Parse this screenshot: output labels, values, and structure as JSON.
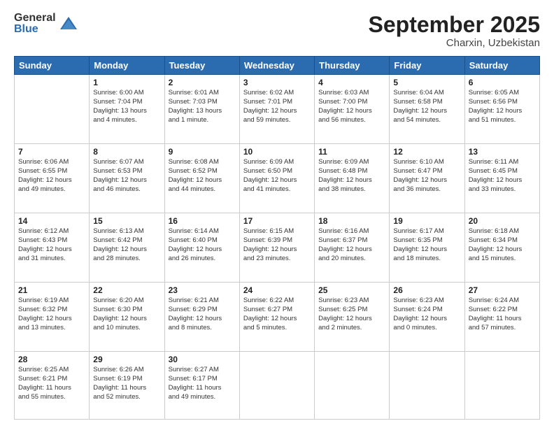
{
  "logo": {
    "general": "General",
    "blue": "Blue"
  },
  "header": {
    "month": "September 2025",
    "location": "Charxin, Uzbekistan"
  },
  "weekdays": [
    "Sunday",
    "Monday",
    "Tuesday",
    "Wednesday",
    "Thursday",
    "Friday",
    "Saturday"
  ],
  "weeks": [
    [
      {
        "day": "",
        "info": ""
      },
      {
        "day": "1",
        "info": "Sunrise: 6:00 AM\nSunset: 7:04 PM\nDaylight: 13 hours\nand 4 minutes."
      },
      {
        "day": "2",
        "info": "Sunrise: 6:01 AM\nSunset: 7:03 PM\nDaylight: 13 hours\nand 1 minute."
      },
      {
        "day": "3",
        "info": "Sunrise: 6:02 AM\nSunset: 7:01 PM\nDaylight: 12 hours\nand 59 minutes."
      },
      {
        "day": "4",
        "info": "Sunrise: 6:03 AM\nSunset: 7:00 PM\nDaylight: 12 hours\nand 56 minutes."
      },
      {
        "day": "5",
        "info": "Sunrise: 6:04 AM\nSunset: 6:58 PM\nDaylight: 12 hours\nand 54 minutes."
      },
      {
        "day": "6",
        "info": "Sunrise: 6:05 AM\nSunset: 6:56 PM\nDaylight: 12 hours\nand 51 minutes."
      }
    ],
    [
      {
        "day": "7",
        "info": "Sunrise: 6:06 AM\nSunset: 6:55 PM\nDaylight: 12 hours\nand 49 minutes."
      },
      {
        "day": "8",
        "info": "Sunrise: 6:07 AM\nSunset: 6:53 PM\nDaylight: 12 hours\nand 46 minutes."
      },
      {
        "day": "9",
        "info": "Sunrise: 6:08 AM\nSunset: 6:52 PM\nDaylight: 12 hours\nand 44 minutes."
      },
      {
        "day": "10",
        "info": "Sunrise: 6:09 AM\nSunset: 6:50 PM\nDaylight: 12 hours\nand 41 minutes."
      },
      {
        "day": "11",
        "info": "Sunrise: 6:09 AM\nSunset: 6:48 PM\nDaylight: 12 hours\nand 38 minutes."
      },
      {
        "day": "12",
        "info": "Sunrise: 6:10 AM\nSunset: 6:47 PM\nDaylight: 12 hours\nand 36 minutes."
      },
      {
        "day": "13",
        "info": "Sunrise: 6:11 AM\nSunset: 6:45 PM\nDaylight: 12 hours\nand 33 minutes."
      }
    ],
    [
      {
        "day": "14",
        "info": "Sunrise: 6:12 AM\nSunset: 6:43 PM\nDaylight: 12 hours\nand 31 minutes."
      },
      {
        "day": "15",
        "info": "Sunrise: 6:13 AM\nSunset: 6:42 PM\nDaylight: 12 hours\nand 28 minutes."
      },
      {
        "day": "16",
        "info": "Sunrise: 6:14 AM\nSunset: 6:40 PM\nDaylight: 12 hours\nand 26 minutes."
      },
      {
        "day": "17",
        "info": "Sunrise: 6:15 AM\nSunset: 6:39 PM\nDaylight: 12 hours\nand 23 minutes."
      },
      {
        "day": "18",
        "info": "Sunrise: 6:16 AM\nSunset: 6:37 PM\nDaylight: 12 hours\nand 20 minutes."
      },
      {
        "day": "19",
        "info": "Sunrise: 6:17 AM\nSunset: 6:35 PM\nDaylight: 12 hours\nand 18 minutes."
      },
      {
        "day": "20",
        "info": "Sunrise: 6:18 AM\nSunset: 6:34 PM\nDaylight: 12 hours\nand 15 minutes."
      }
    ],
    [
      {
        "day": "21",
        "info": "Sunrise: 6:19 AM\nSunset: 6:32 PM\nDaylight: 12 hours\nand 13 minutes."
      },
      {
        "day": "22",
        "info": "Sunrise: 6:20 AM\nSunset: 6:30 PM\nDaylight: 12 hours\nand 10 minutes."
      },
      {
        "day": "23",
        "info": "Sunrise: 6:21 AM\nSunset: 6:29 PM\nDaylight: 12 hours\nand 8 minutes."
      },
      {
        "day": "24",
        "info": "Sunrise: 6:22 AM\nSunset: 6:27 PM\nDaylight: 12 hours\nand 5 minutes."
      },
      {
        "day": "25",
        "info": "Sunrise: 6:23 AM\nSunset: 6:25 PM\nDaylight: 12 hours\nand 2 minutes."
      },
      {
        "day": "26",
        "info": "Sunrise: 6:23 AM\nSunset: 6:24 PM\nDaylight: 12 hours\nand 0 minutes."
      },
      {
        "day": "27",
        "info": "Sunrise: 6:24 AM\nSunset: 6:22 PM\nDaylight: 11 hours\nand 57 minutes."
      }
    ],
    [
      {
        "day": "28",
        "info": "Sunrise: 6:25 AM\nSunset: 6:21 PM\nDaylight: 11 hours\nand 55 minutes."
      },
      {
        "day": "29",
        "info": "Sunrise: 6:26 AM\nSunset: 6:19 PM\nDaylight: 11 hours\nand 52 minutes."
      },
      {
        "day": "30",
        "info": "Sunrise: 6:27 AM\nSunset: 6:17 PM\nDaylight: 11 hours\nand 49 minutes."
      },
      {
        "day": "",
        "info": ""
      },
      {
        "day": "",
        "info": ""
      },
      {
        "day": "",
        "info": ""
      },
      {
        "day": "",
        "info": ""
      }
    ]
  ]
}
